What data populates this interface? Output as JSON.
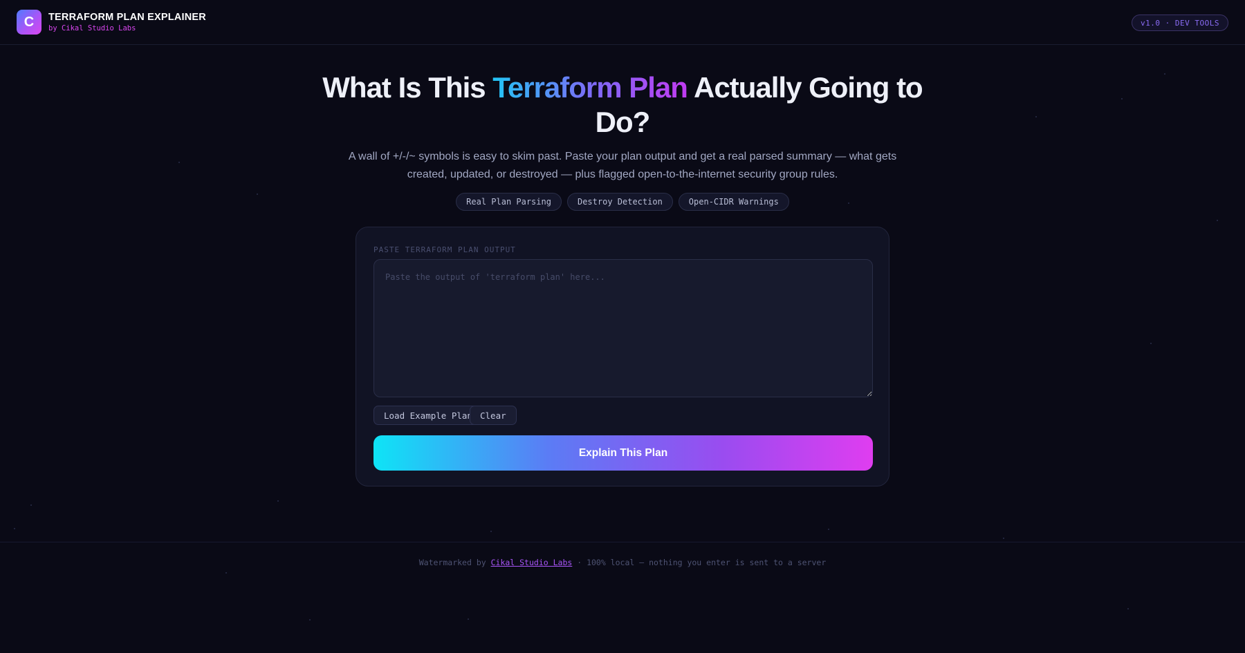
{
  "header": {
    "logo_letter": "C",
    "title": "TERRAFORM PLAN EXPLAINER",
    "subtitle": "by Cikal Studio Labs",
    "version": "v1.0 · DEV TOOLS"
  },
  "hero": {
    "title_before": "What Is This ",
    "title_highlight": "Terraform Plan",
    "title_after": " Actually Going to Do?",
    "subtitle": "A wall of +/-/~ symbols is easy to skim past. Paste your plan output and get a real parsed summary — what gets created, updated, or destroyed — plus flagged open-to-the-internet security group rules.",
    "chips": [
      "Real Plan Parsing",
      "Destroy Detection",
      "Open-CIDR Warnings"
    ]
  },
  "form": {
    "label": "PASTE TERRAFORM PLAN OUTPUT",
    "value": "",
    "placeholder": "Paste the output of 'terraform plan' here...",
    "load_example_label": "Load Example Plan",
    "clear_label": "Clear",
    "submit_label": "Explain This Plan"
  },
  "footer": {
    "prefix": "Watermarked by ",
    "link_text": "Cikal Studio Labs",
    "suffix": " · 100% local — nothing you enter is sent to a server"
  },
  "colors": {
    "background": "#0a0a16",
    "accent_cyan": "#0ee4f6",
    "accent_purple": "#a855f7",
    "accent_magenta": "#df3df0"
  }
}
